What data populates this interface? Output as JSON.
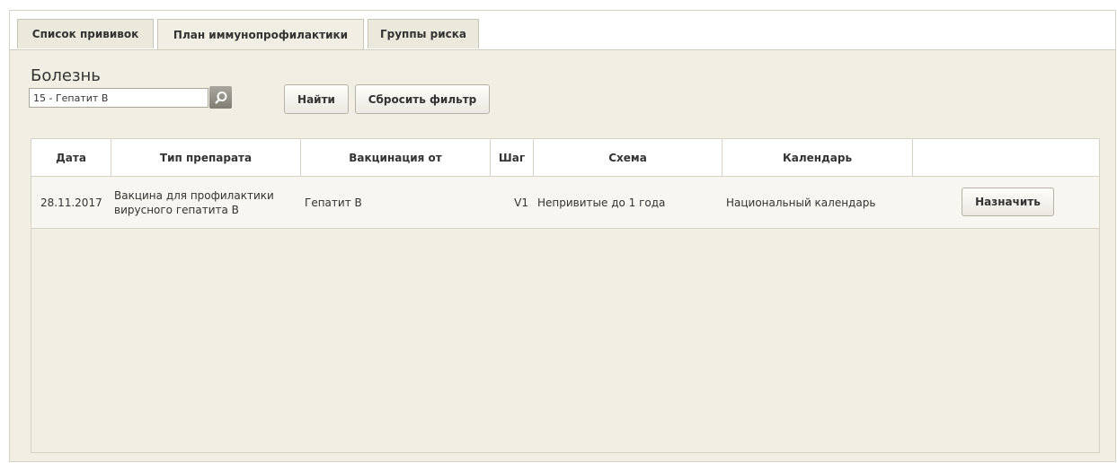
{
  "tabs": [
    {
      "label": "Список прививок",
      "active": false
    },
    {
      "label": "План иммунопрофилактики",
      "active": true
    },
    {
      "label": "Группы риска",
      "active": false
    }
  ],
  "filter": {
    "label": "Болезнь",
    "disease_value": "15 - Гепатит В",
    "search_icon": "search-icon",
    "find_label": "Найти",
    "reset_label": "Сбросить фильтр"
  },
  "table": {
    "columns": [
      "Дата",
      "Тип препарата",
      "Вакцинация от",
      "Шаг",
      "Схема",
      "Календарь",
      ""
    ],
    "rows": [
      {
        "date": "28.11.2017",
        "drug_type": "Вакцина для профилактики вирусного гепатита В",
        "vaccination_from": "Гепатит В",
        "step": "V1",
        "scheme": "Непривитые до 1 года",
        "calendar": "Национальный календарь",
        "action_label": "Назначить"
      }
    ]
  },
  "colors": {
    "panel_bg": "#f1efe4",
    "header_bg": "#ffffff",
    "border": "#d6d3c5"
  }
}
